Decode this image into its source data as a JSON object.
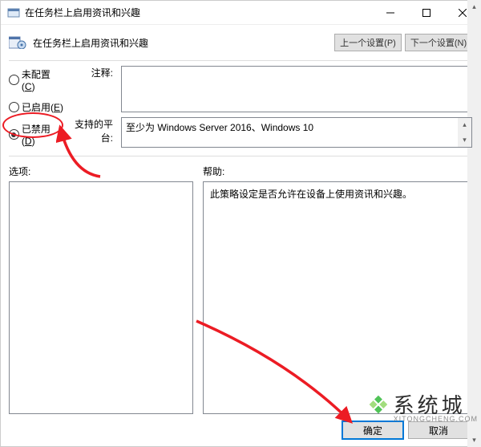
{
  "titlebar": {
    "title": "在任务栏上启用资讯和兴趣"
  },
  "toolbar": {
    "label": "在任务栏上启用资讯和兴趣",
    "prev_label": "上一个设置(P)",
    "next_label": "下一个设置(N)"
  },
  "radios": {
    "not_configured": {
      "text": "未配置(",
      "hotkey": "C",
      "after": ")"
    },
    "enabled": {
      "text": "已启用(",
      "hotkey": "E",
      "after": ")"
    },
    "disabled": {
      "text": "已禁用(",
      "hotkey": "D",
      "after": ")"
    }
  },
  "labels": {
    "comment": "注释:",
    "platform": "支持的平台:",
    "options": "选项:",
    "help": "帮助:"
  },
  "fields": {
    "comment_value": "",
    "platform_value": "至少为 Windows Server 2016、Windows 10"
  },
  "help": {
    "text": "此策略设定是否允许在设备上使用资讯和兴趣。"
  },
  "buttons": {
    "ok": "确定",
    "cancel": "取消"
  },
  "watermark": {
    "cn": "系统城",
    "en": "XITONGCHENG.COM"
  }
}
